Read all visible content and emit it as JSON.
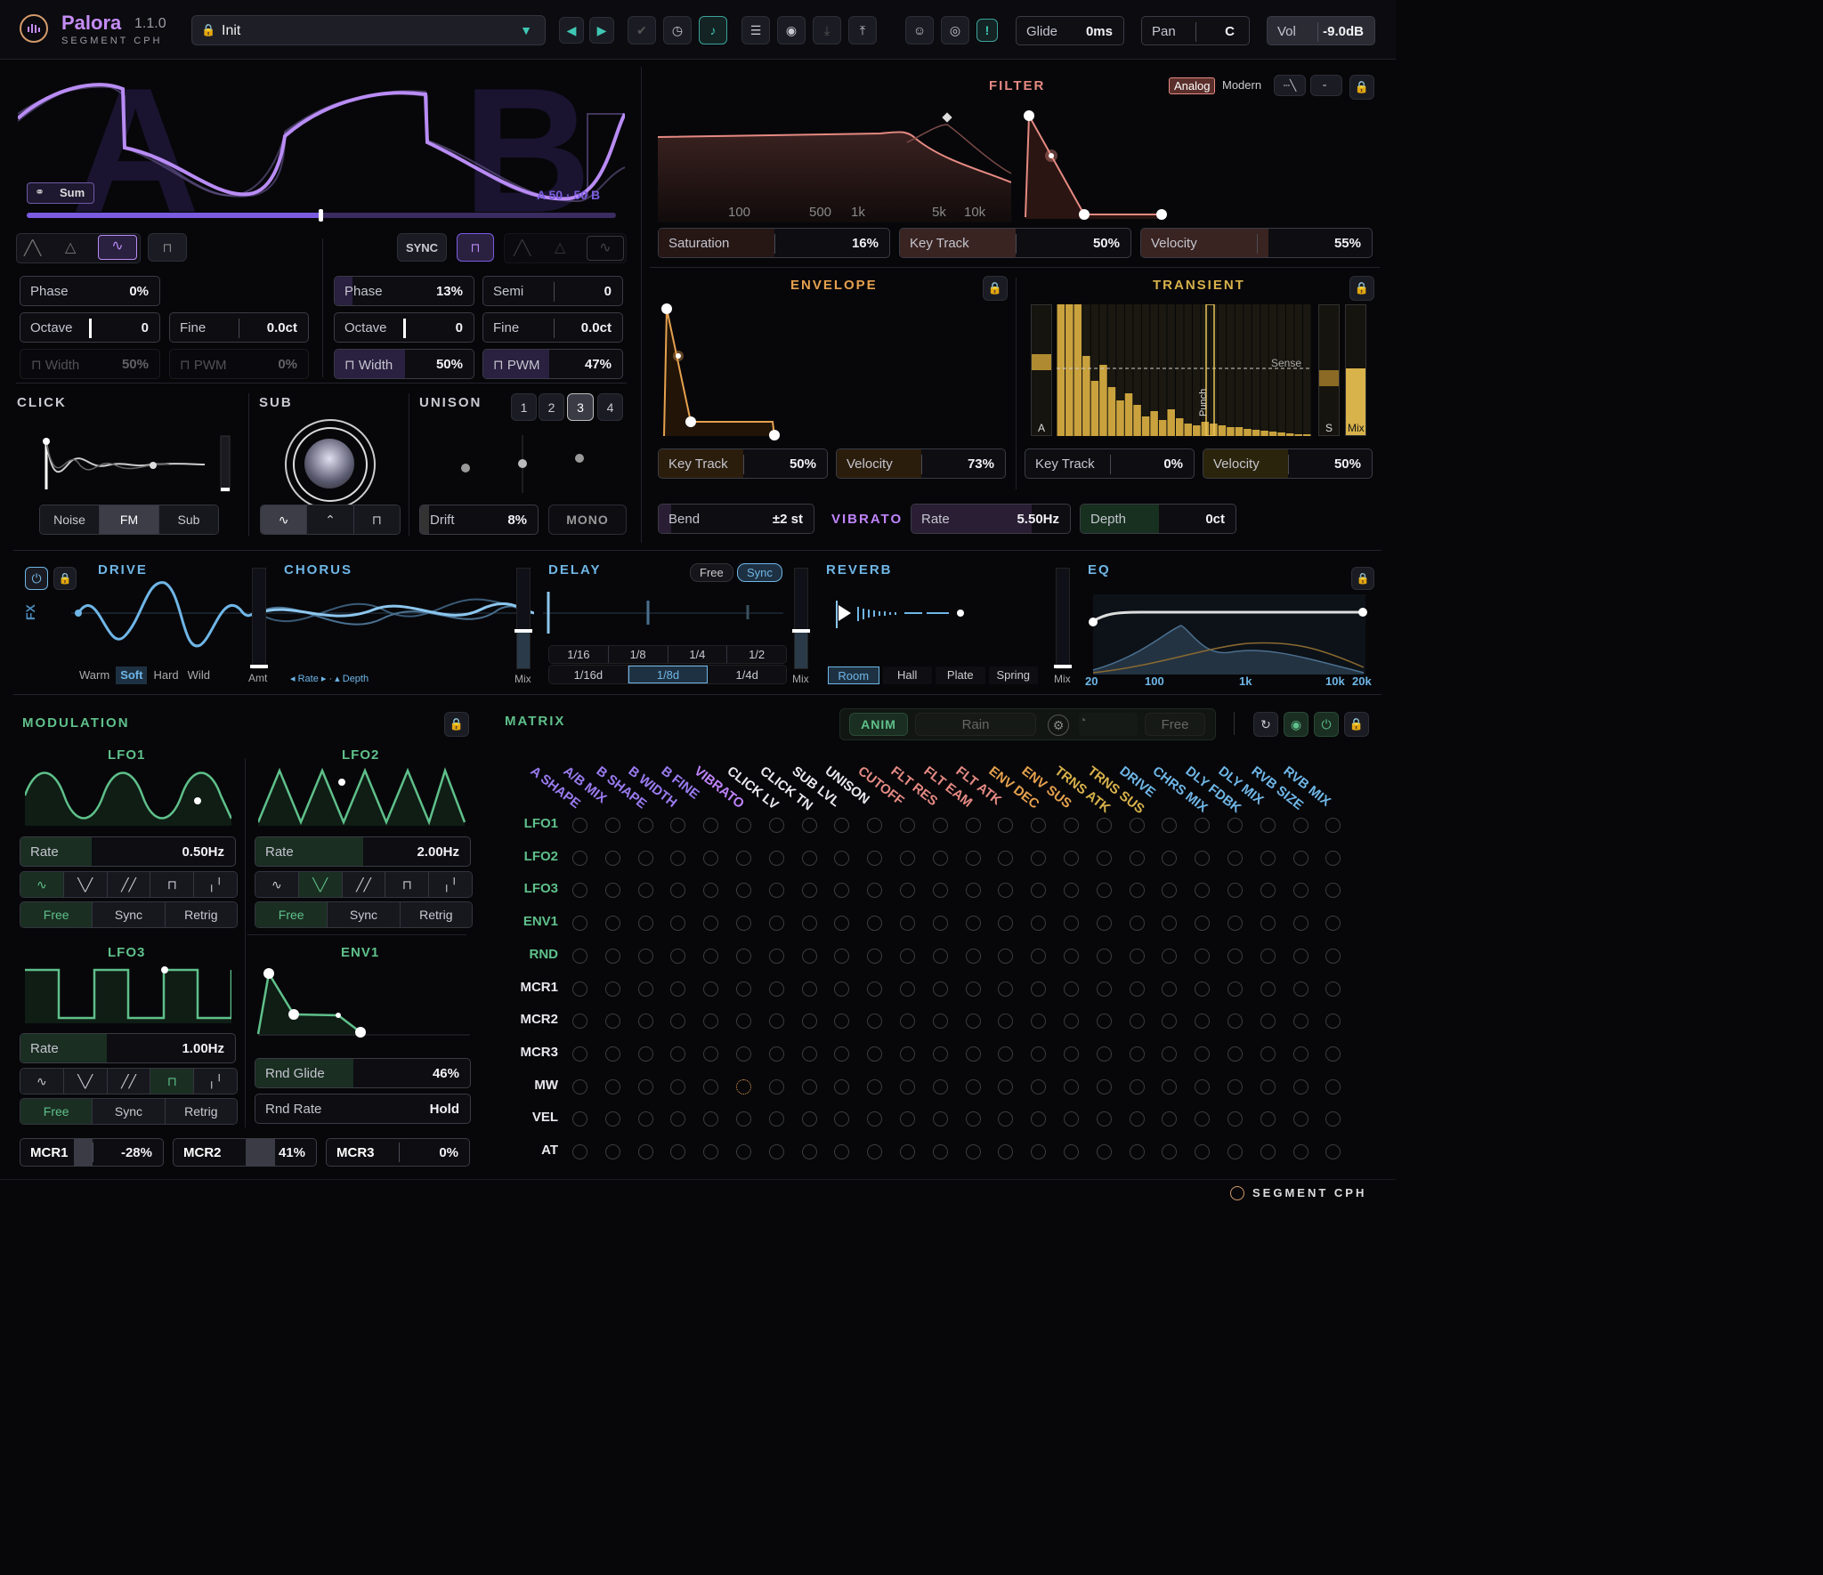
{
  "header": {
    "app_name": "Palora",
    "version": "1.1.0",
    "brand": "SEGMENT CPH",
    "preset": "Init",
    "glide_label": "Glide",
    "glide_value": "0ms",
    "pan_label": "Pan",
    "pan_value": "C",
    "vol_label": "Vol",
    "vol_value": "-9.0dB"
  },
  "osc": {
    "letter_a": "A",
    "letter_b": "B",
    "sum_label": "Sum",
    "mix_readout": "A 50 · 50 B",
    "sync_label": "SYNC",
    "a": {
      "phase_label": "Phase",
      "phase": "0%",
      "octave_label": "Octave",
      "octave": "0",
      "fine_label": "Fine",
      "fine": "0.0ct",
      "width_label": "Width",
      "width": "50%",
      "pwm_label": "PWM",
      "pwm": "0%"
    },
    "b": {
      "phase_label": "Phase",
      "phase": "13%",
      "semi_label": "Semi",
      "semi": "0",
      "octave_label": "Octave",
      "octave": "0",
      "fine_label": "Fine",
      "fine": "0.0ct",
      "width_label": "Width",
      "width": "50%",
      "pwm_label": "PWM",
      "pwm": "47%"
    }
  },
  "click": {
    "title": "CLICK",
    "modes": [
      "Noise",
      "FM",
      "Sub"
    ],
    "active": "FM"
  },
  "sub": {
    "title": "SUB"
  },
  "unison": {
    "title": "UNISON",
    "voices": [
      "1",
      "2",
      "3",
      "4"
    ],
    "active": "3",
    "drift_label": "Drift",
    "drift": "8%",
    "mono_label": "MONO"
  },
  "filter": {
    "title": "FILTER",
    "mode_analog": "Analog",
    "mode_modern": "Modern",
    "freq_labels": [
      "100",
      "500",
      "1k",
      "5k",
      "10k"
    ],
    "saturation_label": "Saturation",
    "saturation": "16%",
    "keytrack_label": "Key Track",
    "keytrack": "50%",
    "velocity_label": "Velocity",
    "velocity": "55%"
  },
  "envelope": {
    "title": "ENVELOPE",
    "keytrack_label": "Key Track",
    "keytrack": "50%",
    "velocity_label": "Velocity",
    "velocity": "73%"
  },
  "transient": {
    "title": "TRANSIENT",
    "a_label": "A",
    "s_label": "S",
    "mix_label": "Mix",
    "sense_label": "Sense",
    "punch_label": "Punch",
    "keytrack_label": "Key Track",
    "keytrack": "0%",
    "velocity_label": "Velocity",
    "velocity": "50%"
  },
  "bend": {
    "label": "Bend",
    "value": "±2 st"
  },
  "vibrato": {
    "title": "VIBRATO",
    "rate_label": "Rate",
    "rate": "5.50Hz",
    "depth_label": "Depth",
    "depth": "0ct"
  },
  "fx": {
    "label": "FX",
    "drive": {
      "title": "DRIVE",
      "modes": [
        "Warm",
        "Soft",
        "Hard",
        "Wild"
      ],
      "active": "Soft",
      "amt_label": "Amt"
    },
    "chorus": {
      "title": "CHORUS",
      "hint": "◂ Rate ▸ · ▴ Depth",
      "mix_label": "Mix"
    },
    "delay": {
      "title": "DELAY",
      "free_label": "Free",
      "sync_label": "Sync",
      "times_row1": [
        "1/16",
        "1/8",
        "1/4",
        "1/2"
      ],
      "times_row2": [
        "1/16d",
        "1/8d",
        "1/4d"
      ],
      "active": "1/8d",
      "mix_label": "Mix"
    },
    "reverb": {
      "title": "REVERB",
      "modes": [
        "Room",
        "Hall",
        "Plate",
        "Spring"
      ],
      "active": "Room",
      "mix_label": "Mix"
    },
    "eq": {
      "title": "EQ",
      "freq_labels": [
        "20",
        "100",
        "1k",
        "10k",
        "20k"
      ]
    }
  },
  "modulation": {
    "title": "MODULATION",
    "lfo1": {
      "title": "LFO1",
      "rate_label": "Rate",
      "rate": "0.50Hz",
      "modes": [
        "Free",
        "Sync",
        "Retrig"
      ],
      "active": "Free"
    },
    "lfo2": {
      "title": "LFO2",
      "rate_label": "Rate",
      "rate": "2.00Hz",
      "modes": [
        "Free",
        "Sync",
        "Retrig"
      ],
      "active": "Free"
    },
    "lfo3": {
      "title": "LFO3",
      "rate_label": "Rate",
      "rate": "1.00Hz",
      "modes": [
        "Free",
        "Sync",
        "Retrig"
      ],
      "active": "Free"
    },
    "env1": {
      "title": "ENV1",
      "rnd_glide_label": "Rnd Glide",
      "rnd_glide": "46%",
      "rnd_rate_label": "Rnd Rate",
      "rnd_rate": "Hold"
    },
    "macros": [
      {
        "label": "MCR1",
        "value": "-28%"
      },
      {
        "label": "MCR2",
        "value": "41%"
      },
      {
        "label": "MCR3",
        "value": "0%"
      }
    ]
  },
  "matrix": {
    "title": "MATRIX",
    "anim_label": "ANIM",
    "anim_mode": "Rain",
    "free_label": "Free",
    "columns": [
      "A SHAPE",
      "A/B MIX",
      "B SHAPE",
      "B WIDTH",
      "B FINE",
      "VIBRATO",
      "CLICK LV",
      "CLICK TN",
      "SUB LVL",
      "UNISON",
      "CUTOFF",
      "FLT RES",
      "FLT EAM",
      "FLT ATK",
      "ENV DEC",
      "ENV SUS",
      "TRNS ATK",
      "TRNS SUS",
      "DRIVE",
      "CHRS MIX",
      "DLY FDBK",
      "DLY MIX",
      "RVB SIZE",
      "RVB MIX"
    ],
    "rows": [
      "LFO1",
      "LFO2",
      "LFO3",
      "ENV1",
      "RND",
      "MCR1",
      "MCR2",
      "MCR3",
      "MW",
      "VEL",
      "AT"
    ]
  },
  "footer": {
    "brand": "SEGMENT CPH"
  },
  "colors": {
    "purple": "#b98cf5",
    "teal": "#3fc7b5",
    "filter": "#e58a82",
    "envelope": "#e5a14e",
    "transient": "#d8b24b",
    "vibrato": "#c084fc",
    "fx": "#6fb6e6",
    "mod": "#5fc08a"
  }
}
